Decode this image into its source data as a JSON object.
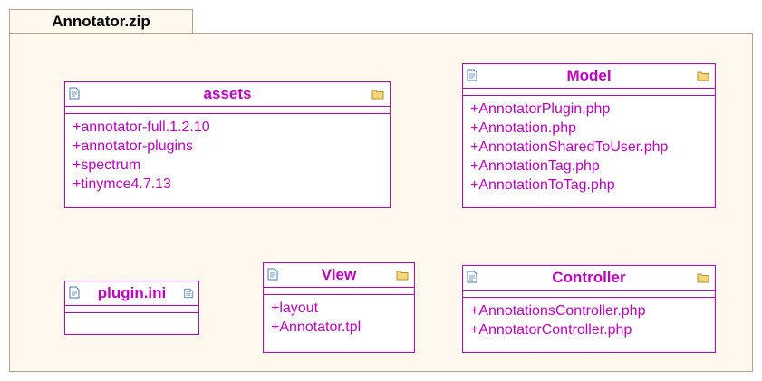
{
  "package": {
    "name": "Annotator.zip"
  },
  "classes": {
    "assets": {
      "name": "assets",
      "icon": "folder-icon",
      "members": [
        "+annotator-full.1.2.10",
        "+annotator-plugins",
        "+spectrum",
        "+tinymce4.7.13"
      ]
    },
    "model": {
      "name": "Model",
      "icon": "folder-icon",
      "members": [
        "+AnnotatorPlugin.php",
        "+Annotation.php",
        "+AnnotationSharedToUser.php",
        "+AnnotationTag.php",
        "+AnnotationToTag.php"
      ]
    },
    "plugin_ini": {
      "name": "plugin.ini",
      "icon": "document-icon",
      "members": []
    },
    "view": {
      "name": "View",
      "icon": "folder-icon",
      "members": [
        "+layout",
        "+Annotator.tpl"
      ]
    },
    "controller": {
      "name": "Controller",
      "icon": "folder-icon",
      "members": [
        "+AnnotationsController.php",
        "+AnnotatorController.php"
      ]
    }
  },
  "colors": {
    "element": "#c000c0",
    "package_fill": "#fff8ee",
    "package_border": "#b8a288"
  }
}
